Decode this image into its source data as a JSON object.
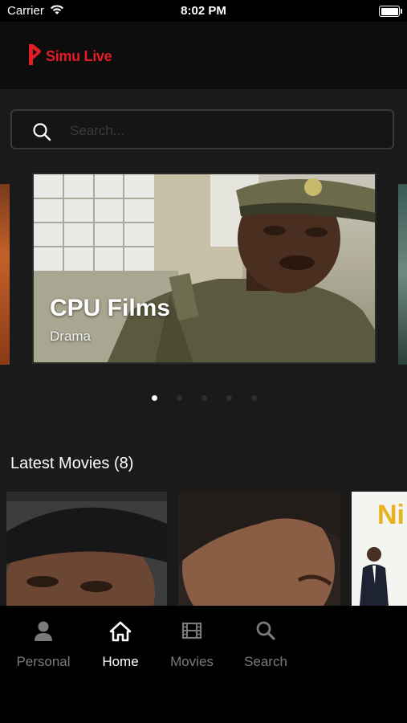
{
  "status_bar": {
    "carrier": "Carrier",
    "time": "8:02 PM"
  },
  "header": {
    "logo_text": "Simu Live",
    "brand_color": "#e41c23"
  },
  "search": {
    "placeholder": "Search..."
  },
  "carousel": {
    "slides": [
      {
        "title": "CPU Films",
        "genre": "Drama"
      }
    ],
    "page_count": 5,
    "active_index": 0
  },
  "latest": {
    "title": "Latest Movies (8)",
    "posters": [
      {
        "icon": "poster-man-beanie"
      },
      {
        "icon": "poster-woman-closeup"
      },
      {
        "icon": "poster-man-suit",
        "text": "Ni"
      }
    ]
  },
  "tabbar": {
    "items": [
      {
        "label": "Personal",
        "icon": "person-icon",
        "active": false
      },
      {
        "label": "Home",
        "icon": "home-icon",
        "active": true
      },
      {
        "label": "Movies",
        "icon": "film-icon",
        "active": false
      },
      {
        "label": "Search",
        "icon": "search-icon",
        "active": false
      }
    ]
  }
}
